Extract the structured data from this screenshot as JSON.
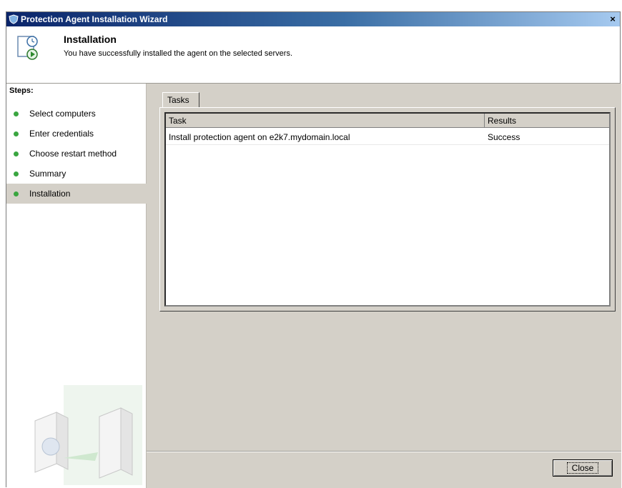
{
  "window": {
    "title": "Protection Agent Installation Wizard",
    "close_glyph": "×"
  },
  "header": {
    "title": "Installation",
    "subtitle": "You have successfully installed the agent on the selected servers.",
    "icon": "installation-clock-icon"
  },
  "steps": {
    "title": "Steps:",
    "items": [
      {
        "label": "Select computers",
        "active": false
      },
      {
        "label": "Enter credentials",
        "active": false
      },
      {
        "label": "Choose restart method",
        "active": false
      },
      {
        "label": "Summary",
        "active": false
      },
      {
        "label": "Installation",
        "active": true
      }
    ],
    "status_color": "#3aa640"
  },
  "tabs": [
    {
      "label": "Tasks"
    }
  ],
  "task_list": {
    "columns": [
      "Task",
      "Results"
    ],
    "rows": [
      {
        "task": "Install protection agent on e2k7.mydomain.local",
        "result": "Success"
      }
    ]
  },
  "footer": {
    "close_label": "Close"
  }
}
